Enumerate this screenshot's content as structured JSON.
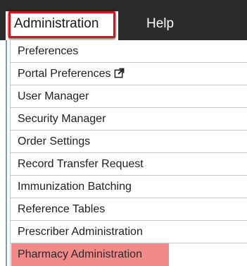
{
  "menubar": {
    "items": [
      {
        "label": "Administration",
        "active": true
      },
      {
        "label": "Help",
        "active": false
      }
    ]
  },
  "dropdown": {
    "items": [
      {
        "label": "Preferences"
      },
      {
        "label": "Portal Preferences",
        "icon": "external-link-icon"
      },
      {
        "label": "User Manager"
      },
      {
        "label": "Security Manager"
      },
      {
        "label": "Order Settings"
      },
      {
        "label": "Record Transfer Request"
      },
      {
        "label": "Immunization Batching"
      },
      {
        "label": "Reference Tables"
      },
      {
        "label": "Prescriber Administration"
      },
      {
        "label": "Pharmacy Administration",
        "highlighted": true
      }
    ]
  },
  "colors": {
    "menubar_bg": "#2b2b2b",
    "active_outline": "#d8141a",
    "highlighted_item_bg": "#f38a8a"
  }
}
